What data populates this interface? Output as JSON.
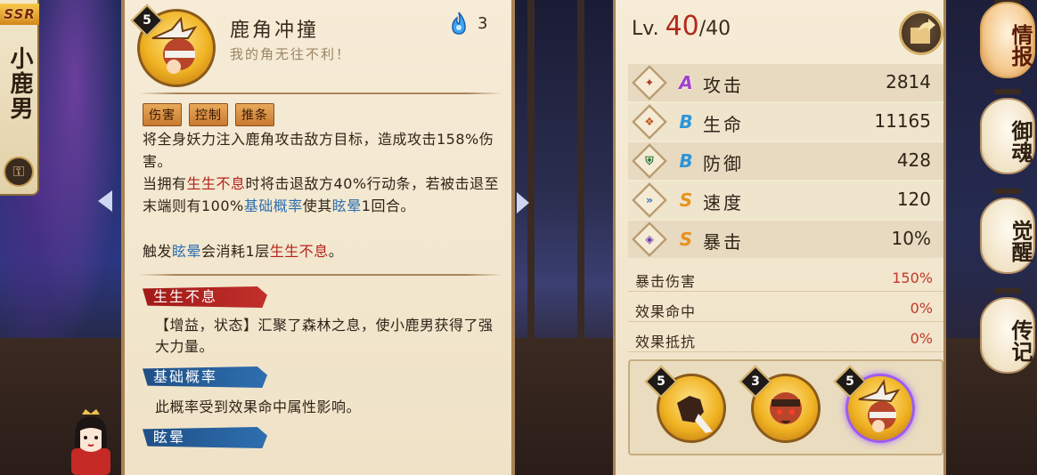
{
  "character": {
    "rarity": "SSR",
    "name": "小鹿男"
  },
  "skill": {
    "level": "5",
    "title": "鹿角冲撞",
    "subtitle": "我的角无往不利！",
    "orb_cost": "3",
    "tags": [
      "伤害",
      "控制",
      "推条"
    ],
    "desc": {
      "p1": "将全身妖力注入鹿角攻击敌方目标，造成攻击158%伤害。",
      "p2_a": "当拥有",
      "p2_kw1": "生生不息",
      "p2_b": "时将击退敌方40%行动条，若被击退至末端则有100%",
      "p2_kw2": "基础概率",
      "p2_c": "使其",
      "p2_kw3": "眩晕",
      "p2_d": "1回合。",
      "p3_a": "触发",
      "p3_kw1": "眩晕",
      "p3_b": "会消耗1层",
      "p3_kw2": "生生不息",
      "p3_c": "。"
    },
    "keywords": [
      {
        "title": "生生不息",
        "text": "【增益，状态】汇聚了森林之息，使小鹿男获得了强大力量。"
      },
      {
        "title": "基础概率",
        "text": "此概率受到效果命中属性影响。"
      },
      {
        "title": "眩晕",
        "text": ""
      }
    ]
  },
  "stats": {
    "level_prefix": "Lv.",
    "level_current": "40",
    "level_max": "/40",
    "rows": [
      {
        "grade": "A",
        "name": "攻击",
        "value": "2814",
        "icon": "attack-icon"
      },
      {
        "grade": "B",
        "name": "生命",
        "value": "11165",
        "icon": "health-icon"
      },
      {
        "grade": "B",
        "name": "防御",
        "value": "428",
        "icon": "defense-icon"
      },
      {
        "grade": "S",
        "name": "速度",
        "value": "120",
        "icon": "speed-icon"
      },
      {
        "grade": "S",
        "name": "暴击",
        "value": "10%",
        "icon": "crit-icon"
      }
    ],
    "sub_rows": [
      {
        "name": "暴击伤害",
        "value": "150%"
      },
      {
        "name": "效果命中",
        "value": "0%"
      },
      {
        "name": "效果抵抗",
        "value": "0%"
      }
    ],
    "skill_tray": [
      {
        "level": "5",
        "icon": "fist-skill-icon"
      },
      {
        "level": "3",
        "icon": "roar-skill-icon"
      },
      {
        "level": "5",
        "icon": "antler-charge-skill-icon"
      }
    ]
  },
  "side_tabs": [
    "情报",
    "御魂",
    "觉醒",
    "传记"
  ],
  "colors": {
    "accent_red": "#b4231c",
    "accent_blue": "#2e6fb0",
    "panel_bg": "#f6ecd7",
    "grade_A": "#a23fd0",
    "grade_B": "#2b95d8",
    "grade_S": "#e6921e"
  }
}
